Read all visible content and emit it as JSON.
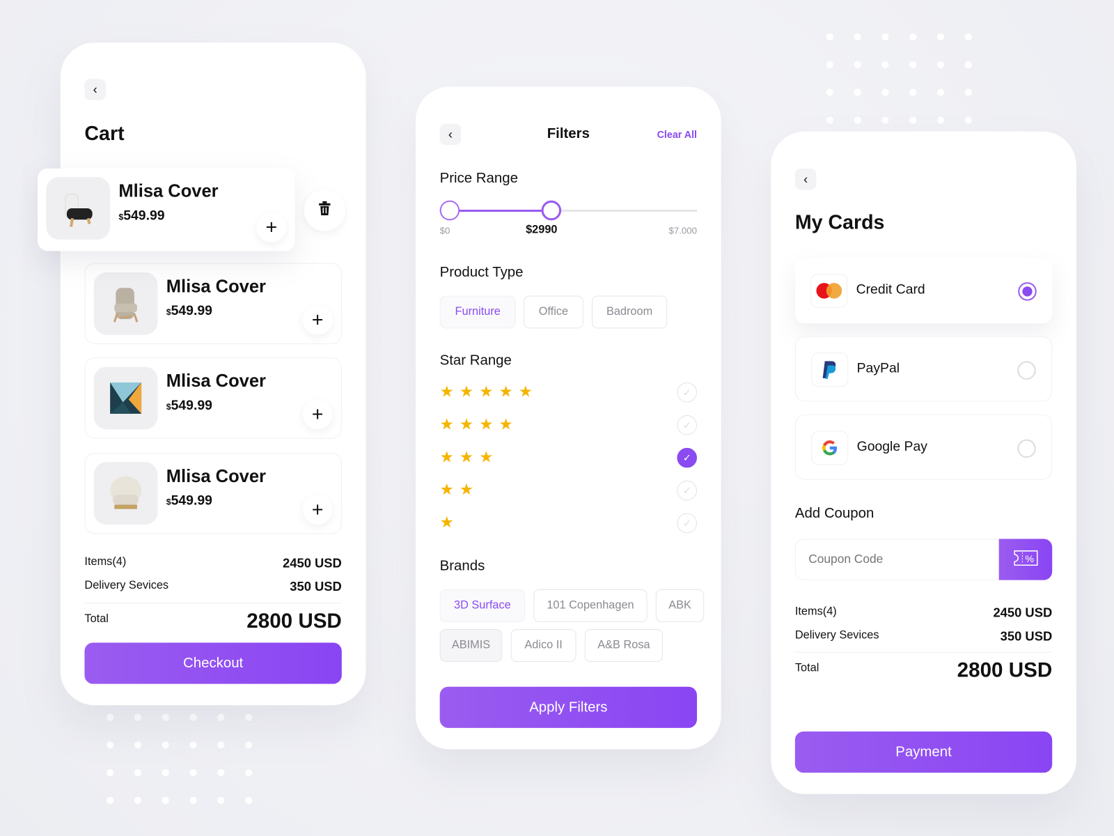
{
  "colors": {
    "accent": "#8a4bf0",
    "star": "#f5b400"
  },
  "cart": {
    "title": "Cart",
    "items": [
      {
        "name": "Mlisa Cover",
        "currency": "$",
        "price": "549.99"
      },
      {
        "name": "Mlisa Cover",
        "currency": "$",
        "price": "549.99"
      },
      {
        "name": "Mlisa Cover",
        "currency": "$",
        "price": "549.99"
      },
      {
        "name": "Mlisa Cover",
        "currency": "$",
        "price": "549.99"
      }
    ],
    "items_label": "Items(4)",
    "items_value": "2450 USD",
    "delivery_label": "Delivery Sevices",
    "delivery_value": "350 USD",
    "total_label": "Total",
    "total_value": "2800 USD",
    "checkout": "Checkout"
  },
  "filters": {
    "title": "Filters",
    "clear_all": "Clear All",
    "price_range": {
      "label": "Price Range",
      "min_label": "$0",
      "value_label": "$2990",
      "max_label": "$7.000",
      "min": 0,
      "max": 7000,
      "low": 0,
      "high": 2990
    },
    "product_type": {
      "label": "Product Type",
      "options": [
        "Furniture",
        "Office",
        "Badroom"
      ],
      "selected": "Furniture"
    },
    "star_range": {
      "label": "Star Range",
      "options": [
        5,
        4,
        3,
        2,
        1
      ],
      "selected": 3
    },
    "brands": {
      "label": "Brands",
      "options": [
        "3D Surface",
        "101 Copenhagen",
        "ABK",
        "ABIMIS",
        "Adico II",
        "A&B Rosa"
      ],
      "selected": "3D Surface"
    },
    "apply": "Apply Filters"
  },
  "cards": {
    "title": "My Cards",
    "methods": [
      {
        "label": "Credit Card",
        "icon": "mastercard-icon",
        "selected": true
      },
      {
        "label": "PayPal",
        "icon": "paypal-icon",
        "selected": false
      },
      {
        "label": "Google Pay",
        "icon": "google-icon",
        "selected": false
      }
    ],
    "coupon_label": "Add Coupon",
    "coupon_placeholder": "Coupon Code",
    "items_label": "Items(4)",
    "items_value": "2450 USD",
    "delivery_label": "Delivery Sevices",
    "delivery_value": "350 USD",
    "total_label": "Total",
    "total_value": "2800 USD",
    "payment": "Payment"
  }
}
